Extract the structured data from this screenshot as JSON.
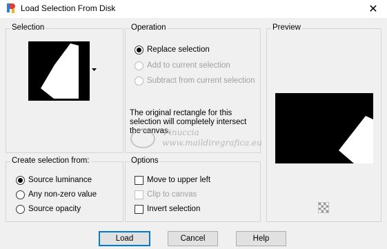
{
  "window": {
    "title": "Load Selection From Disk",
    "close_glyph": "✕"
  },
  "selection_group": {
    "label": "Selection"
  },
  "operation_group": {
    "label": "Operation",
    "options": [
      {
        "label": "Replace selection",
        "checked": true,
        "enabled": true
      },
      {
        "label": "Add to current selection",
        "checked": false,
        "enabled": false
      },
      {
        "label": "Subtract from current selection",
        "checked": false,
        "enabled": false
      }
    ],
    "message": "The original rectangle for this selection will completely intersect the canvas."
  },
  "preview_group": {
    "label": "Preview"
  },
  "create_group": {
    "label": "Create selection from:",
    "options": [
      {
        "label": "Source luminance",
        "checked": true
      },
      {
        "label": "Any non-zero value",
        "checked": false
      },
      {
        "label": "Source opacity",
        "checked": false
      }
    ]
  },
  "options_group": {
    "label": "Options",
    "items": [
      {
        "label": "Move to upper left",
        "checked": false,
        "enabled": true
      },
      {
        "label": "Clip to canvas",
        "checked": false,
        "enabled": false
      },
      {
        "label": "Invert selection",
        "checked": false,
        "enabled": true
      }
    ]
  },
  "watermark": {
    "line1": "Pinuccia",
    "line2": "www.maildiregrafica.eu"
  },
  "buttons": {
    "load": "Load",
    "cancel": "Cancel",
    "help": "Help"
  }
}
